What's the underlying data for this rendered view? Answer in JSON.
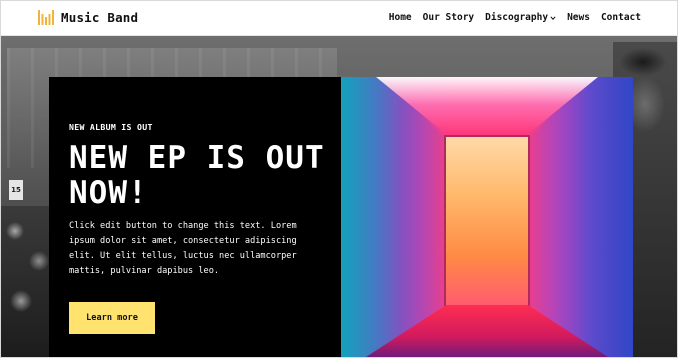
{
  "site": {
    "brand": "Music Band",
    "logo_icon": "equalizer-bars-icon",
    "accent_color": "#f2b33d"
  },
  "nav": {
    "items": [
      {
        "label": "Home"
      },
      {
        "label": "Our Story"
      },
      {
        "label": "Discography",
        "has_dropdown": true
      },
      {
        "label": "News"
      },
      {
        "label": "Contact"
      }
    ]
  },
  "hero": {
    "eyebrow": "NEW ALBUM IS OUT",
    "headline": "NEW EP IS OUT NOW!",
    "body": "Click edit button to change this text. Lorem ipsum dolor sit amet, consectetur adipiscing elit. Ut elit tellus, luctus nec ullamcorper mattis, pulvinar dapibus leo.",
    "cta_label": "Learn more",
    "cta_color": "#ffe36e",
    "panel_color": "#000000",
    "sign_text": "15"
  }
}
